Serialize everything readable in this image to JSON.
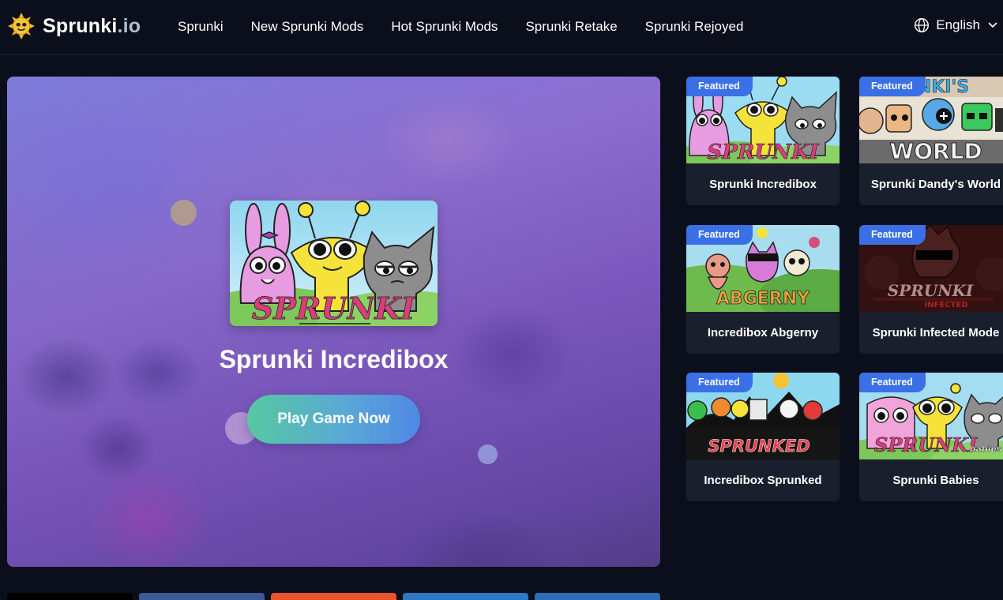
{
  "header": {
    "logo": {
      "name": "Sprunki",
      "tld": ".io"
    },
    "nav": [
      {
        "label": "Sprunki"
      },
      {
        "label": "New Sprunki Mods"
      },
      {
        "label": "Hot Sprunki Mods"
      },
      {
        "label": "Sprunki Retake"
      },
      {
        "label": "Sprunki Rejoyed"
      }
    ],
    "language": {
      "label": "English",
      "icon": "globe-icon"
    }
  },
  "hero": {
    "title": "Sprunki Incredibox",
    "thumb_text": "SPRUNKI",
    "play_label": "Play Game Now"
  },
  "cards": [
    {
      "badge": "Featured",
      "title": "Sprunki Incredibox",
      "art_text": "SPRUNKI"
    },
    {
      "badge": "Featured",
      "title": "Sprunki Dandy's World",
      "art_text": "WORLD"
    },
    {
      "badge": "Featured",
      "title": "Incredibox Abgerny",
      "art_text": "ABGERNY"
    },
    {
      "badge": "Featured",
      "title": "Sprunki Infected Mode",
      "art_text": "SPRUNKI"
    },
    {
      "badge": "Featured",
      "title": "Incredibox Sprunked",
      "art_text": "SPRUNKED"
    },
    {
      "badge": "Featured",
      "title": "Sprunki Babies",
      "art_text": "SPRUNKI"
    }
  ],
  "colors": {
    "page_bg": "#0b0f1c",
    "card_bg": "#1a1f2e",
    "badge": "#3b6fe6",
    "play_gradient": [
      "#57c8a0",
      "#4f88e6"
    ],
    "share_bar": [
      "#000000",
      "#3b5998",
      "#e9542f",
      "#2f78c4",
      "#2c6fb8"
    ]
  }
}
